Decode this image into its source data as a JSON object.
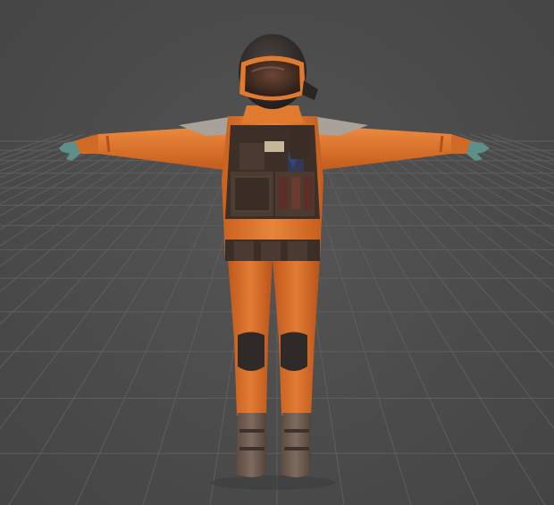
{
  "scene": {
    "background_color": "#4a4a4a",
    "grid_line_color": "#5e5e5e",
    "subject": "astronaut-character-model",
    "pose": "t-pose"
  },
  "character": {
    "suit_color": "#e07a2f",
    "suit_shadow_color": "#b8561c",
    "vest_color": "#3d2f27",
    "helmet_color": "#2a2624",
    "visor_color": "#5a3a2a",
    "boot_color": "#6b5a4f",
    "glove_color": "#5f8f8a",
    "shoulder_pad_color": "#a8a29a"
  }
}
